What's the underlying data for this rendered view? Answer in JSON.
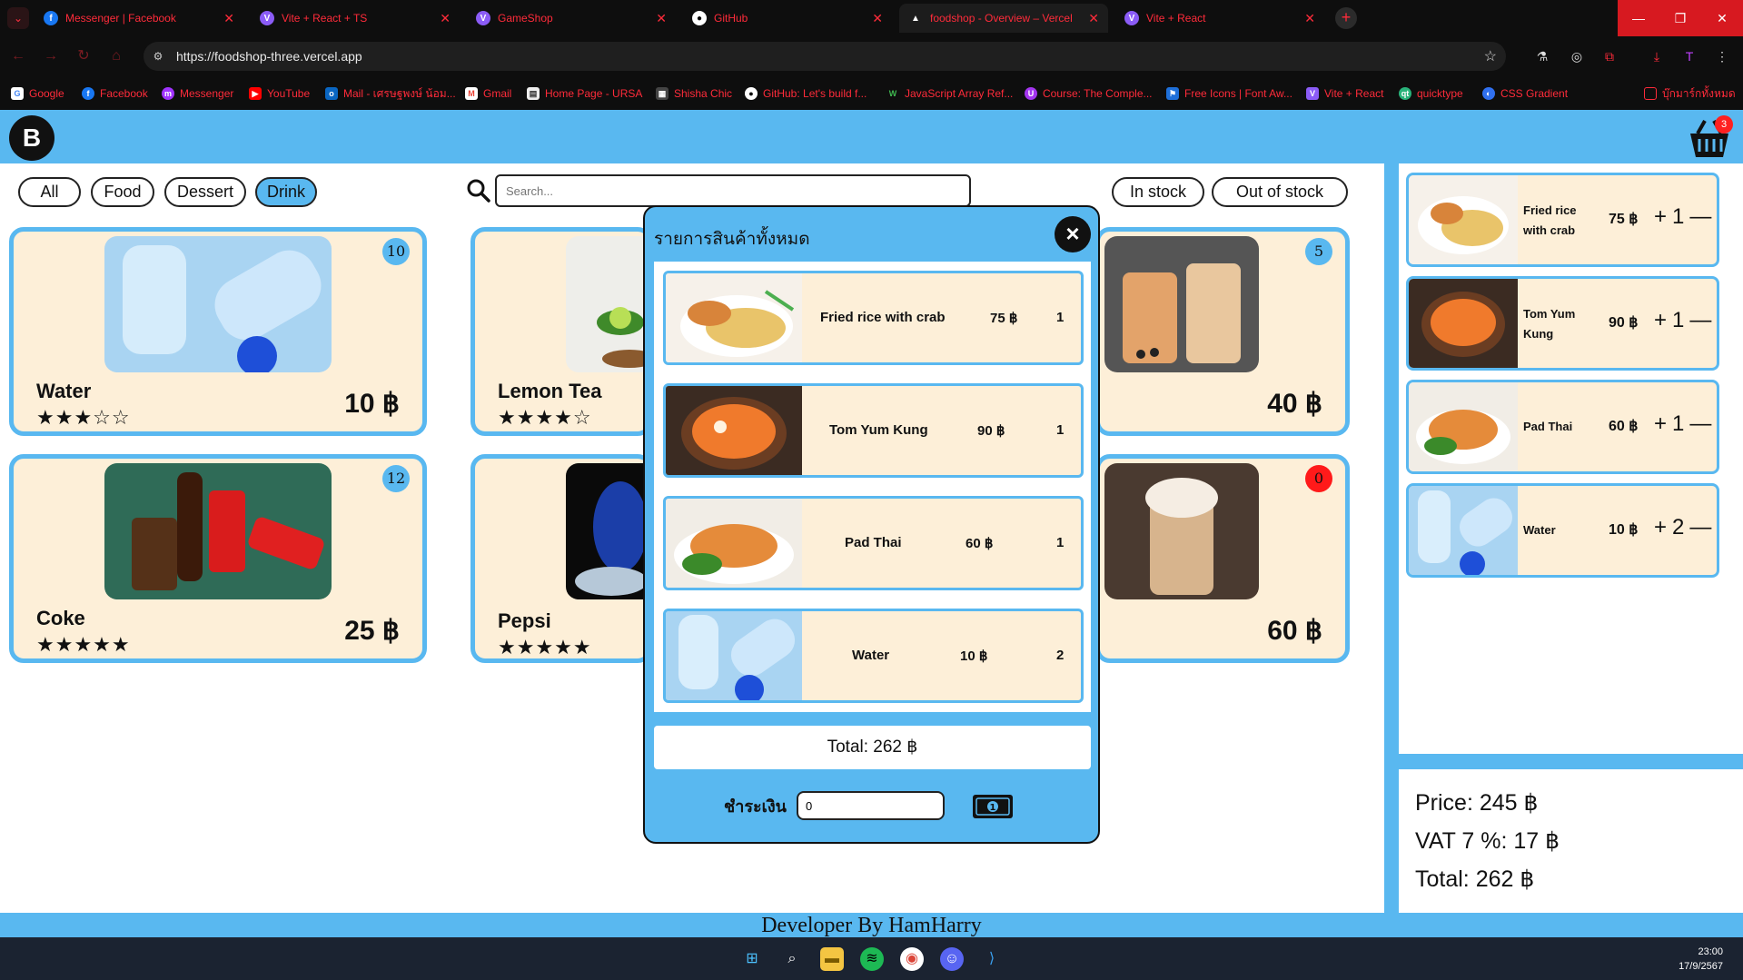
{
  "browser": {
    "tabs": [
      {
        "title": "Messenger | Facebook",
        "icon": "facebook-icon"
      },
      {
        "title": "Vite + React + TS",
        "icon": "vite-icon"
      },
      {
        "title": "GameShop",
        "icon": "vite-icon"
      },
      {
        "title": "GitHub",
        "icon": "github-icon"
      },
      {
        "title": "foodshop - Overview – Vercel",
        "icon": "vercel-icon"
      },
      {
        "title": "Vite + React",
        "icon": "vite-icon"
      }
    ],
    "url": "https://foodshop-three.vercel.app",
    "bookmarks": [
      "Google",
      "Facebook",
      "Messenger",
      "YouTube",
      "Mail - เศรษฐพงษ์ น้อม...",
      "Gmail",
      "Home Page - URSA",
      "Shisha Chic",
      "GitHub: Let's build f...",
      "JavaScript Array Ref...",
      "Course: The Comple...",
      "Free Icons | Font Aw...",
      "Vite + React",
      "quicktype",
      "CSS Gradient",
      "บุ๊กมาร์กทั้งหมด"
    ]
  },
  "shop": {
    "categories": [
      "All",
      "Food",
      "Dessert",
      "Drink"
    ],
    "selected_category": "Drink",
    "search_placeholder": "Search...",
    "stock_filters": [
      "In stock",
      "Out of stock"
    ],
    "cart_count": "3",
    "products": [
      {
        "name": "Water",
        "price": "10 ฿",
        "qty": "10",
        "stars": "★★★☆☆",
        "rating": 3
      },
      {
        "name": "Lemon Tea",
        "price": "",
        "qty": "",
        "stars": "★★★★☆",
        "rating": 4
      },
      {
        "name": "",
        "price": "40 ฿",
        "qty": "5",
        "stars": "",
        "rating": null
      },
      {
        "name": "Coke",
        "price": "25 ฿",
        "qty": "12",
        "stars": "★★★★★",
        "rating": 5
      },
      {
        "name": "Pepsi",
        "price": "",
        "qty": "",
        "stars": "★★★★★",
        "rating": 5
      },
      {
        "name": "",
        "price": "60 ฿",
        "qty": "0",
        "stars": "",
        "rating": null
      }
    ]
  },
  "cart_sidebar": {
    "items": [
      {
        "name": "Fried rice with crab",
        "price": "75 ฿",
        "plus": "+",
        "qty": "1",
        "minus": "—"
      },
      {
        "name": "Tom Yum Kung",
        "price": "90 ฿",
        "plus": "+",
        "qty": "1",
        "minus": "—"
      },
      {
        "name": "Pad Thai",
        "price": "60 ฿",
        "plus": "+",
        "qty": "1",
        "minus": "—"
      },
      {
        "name": "Water",
        "price": "10 ฿",
        "plus": "+",
        "qty": "2",
        "minus": "—"
      }
    ],
    "price": "Price: 245 ฿",
    "vat": "VAT 7 %: 17 ฿",
    "total": "Total: 262 ฿"
  },
  "modal": {
    "title": "รายการสินค้าทั้งหมด",
    "close": "×",
    "items": [
      {
        "name": "Fried rice with crab",
        "price": "75 ฿",
        "qty": "1"
      },
      {
        "name": "Tom Yum Kung",
        "price": "90 ฿",
        "qty": "1"
      },
      {
        "name": "Pad Thai",
        "price": "60 ฿",
        "qty": "1"
      },
      {
        "name": "Water",
        "price": "10 ฿",
        "qty": "2"
      }
    ],
    "total": "Total: 262 ฿",
    "pay_label": "ชำระเงิน",
    "pay_value": "0"
  },
  "footer": {
    "text": "Developer By HamHarry"
  },
  "taskbar": {
    "time": "23:00",
    "date": "17/9/2567"
  },
  "colors": {
    "accent": "#59b8f0",
    "card_bg": "#fdefd8",
    "browser_accent": "#ff2b3a",
    "out_of_stock": "#ff1a1a"
  }
}
